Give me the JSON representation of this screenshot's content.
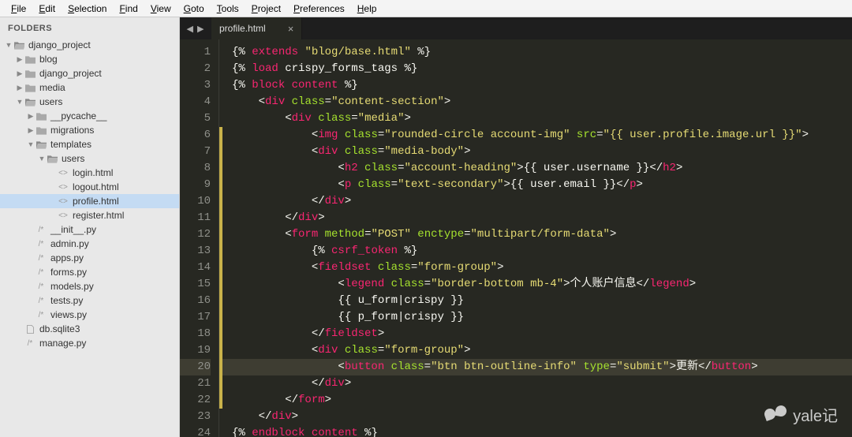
{
  "menu": {
    "items": [
      "File",
      "Edit",
      "Selection",
      "Find",
      "View",
      "Goto",
      "Tools",
      "Project",
      "Preferences",
      "Help"
    ]
  },
  "sidebar": {
    "heading": "FOLDERS",
    "tree": [
      {
        "depth": 1,
        "kind": "folder",
        "twist": "down",
        "label": "django_project"
      },
      {
        "depth": 2,
        "kind": "folder",
        "twist": "right",
        "label": "blog"
      },
      {
        "depth": 2,
        "kind": "folder",
        "twist": "right",
        "label": "django_project"
      },
      {
        "depth": 2,
        "kind": "folder",
        "twist": "right",
        "label": "media"
      },
      {
        "depth": 2,
        "kind": "folder",
        "twist": "down",
        "label": "users"
      },
      {
        "depth": 3,
        "kind": "folder",
        "twist": "right",
        "label": "__pycache__"
      },
      {
        "depth": 3,
        "kind": "folder",
        "twist": "right",
        "label": "migrations"
      },
      {
        "depth": 3,
        "kind": "folder",
        "twist": "down",
        "label": "templates"
      },
      {
        "depth": 4,
        "kind": "folder",
        "twist": "down",
        "label": "users"
      },
      {
        "depth": 5,
        "kind": "html",
        "twist": "",
        "label": "login.html"
      },
      {
        "depth": 5,
        "kind": "html",
        "twist": "",
        "label": "logout.html"
      },
      {
        "depth": 5,
        "kind": "html",
        "twist": "",
        "label": "profile.html",
        "selected": true
      },
      {
        "depth": 5,
        "kind": "html",
        "twist": "",
        "label": "register.html"
      },
      {
        "depth": 3,
        "kind": "py",
        "twist": "",
        "label": "__init__.py"
      },
      {
        "depth": 3,
        "kind": "py",
        "twist": "",
        "label": "admin.py"
      },
      {
        "depth": 3,
        "kind": "py",
        "twist": "",
        "label": "apps.py"
      },
      {
        "depth": 3,
        "kind": "py",
        "twist": "",
        "label": "forms.py"
      },
      {
        "depth": 3,
        "kind": "py",
        "twist": "",
        "label": "models.py"
      },
      {
        "depth": 3,
        "kind": "py",
        "twist": "",
        "label": "tests.py"
      },
      {
        "depth": 3,
        "kind": "py",
        "twist": "",
        "label": "views.py"
      },
      {
        "depth": 2,
        "kind": "file",
        "twist": "",
        "label": "db.sqlite3"
      },
      {
        "depth": 2,
        "kind": "py",
        "twist": "",
        "label": "manage.py"
      }
    ]
  },
  "tabs": {
    "nav": "◀ ▶",
    "open": [
      {
        "title": "profile.html",
        "close": "×"
      }
    ]
  },
  "code": {
    "active_line": 20,
    "lines": [
      [
        [
          "w",
          "{% "
        ],
        [
          "r",
          "extends"
        ],
        [
          "w",
          " "
        ],
        [
          "y",
          "\"blog/base.html\""
        ],
        [
          "w",
          " %}"
        ]
      ],
      [
        [
          "w",
          "{% "
        ],
        [
          "r",
          "load"
        ],
        [
          "w",
          " crispy_forms_tags %}"
        ]
      ],
      [
        [
          "w",
          "{% "
        ],
        [
          "r",
          "block content"
        ],
        [
          "w",
          " %}"
        ]
      ],
      [
        [
          "w",
          "    <"
        ],
        [
          "r",
          "div"
        ],
        [
          "w",
          " "
        ],
        [
          "g",
          "class"
        ],
        [
          "w",
          "="
        ],
        [
          "y",
          "\"content-section\""
        ],
        [
          "w",
          ">"
        ]
      ],
      [
        [
          "w",
          "        <"
        ],
        [
          "r",
          "div"
        ],
        [
          "w",
          " "
        ],
        [
          "g",
          "class"
        ],
        [
          "w",
          "="
        ],
        [
          "y",
          "\"media\""
        ],
        [
          "w",
          ">"
        ]
      ],
      [
        [
          "w",
          "            <"
        ],
        [
          "r",
          "img"
        ],
        [
          "w",
          " "
        ],
        [
          "g",
          "class"
        ],
        [
          "w",
          "="
        ],
        [
          "y",
          "\"rounded-circle account-img\""
        ],
        [
          "w",
          " "
        ],
        [
          "g",
          "src"
        ],
        [
          "w",
          "="
        ],
        [
          "y",
          "\"{{ user.profile.image.url }}\""
        ],
        [
          "w",
          ">"
        ]
      ],
      [
        [
          "w",
          "            <"
        ],
        [
          "r",
          "div"
        ],
        [
          "w",
          " "
        ],
        [
          "g",
          "class"
        ],
        [
          "w",
          "="
        ],
        [
          "y",
          "\"media-body\""
        ],
        [
          "w",
          ">"
        ]
      ],
      [
        [
          "w",
          "                <"
        ],
        [
          "r",
          "h2"
        ],
        [
          "w",
          " "
        ],
        [
          "g",
          "class"
        ],
        [
          "w",
          "="
        ],
        [
          "y",
          "\"account-heading\""
        ],
        [
          "w",
          ">{{ user.username }}</"
        ],
        [
          "r",
          "h2"
        ],
        [
          "w",
          ">"
        ]
      ],
      [
        [
          "w",
          "                <"
        ],
        [
          "r",
          "p"
        ],
        [
          "w",
          " "
        ],
        [
          "g",
          "class"
        ],
        [
          "w",
          "="
        ],
        [
          "y",
          "\"text-secondary\""
        ],
        [
          "w",
          ">{{ user.email }}</"
        ],
        [
          "r",
          "p"
        ],
        [
          "w",
          ">"
        ]
      ],
      [
        [
          "w",
          "            </"
        ],
        [
          "r",
          "div"
        ],
        [
          "w",
          ">"
        ]
      ],
      [
        [
          "w",
          "        </"
        ],
        [
          "r",
          "div"
        ],
        [
          "w",
          ">"
        ]
      ],
      [
        [
          "w",
          "        <"
        ],
        [
          "r",
          "form"
        ],
        [
          "w",
          " "
        ],
        [
          "g",
          "method"
        ],
        [
          "w",
          "="
        ],
        [
          "y",
          "\"POST\""
        ],
        [
          "w",
          " "
        ],
        [
          "g",
          "enctype"
        ],
        [
          "w",
          "="
        ],
        [
          "y",
          "\"multipart/form-data\""
        ],
        [
          "w",
          ">"
        ]
      ],
      [
        [
          "w",
          "            {% "
        ],
        [
          "r",
          "csrf_token"
        ],
        [
          "w",
          " %}"
        ]
      ],
      [
        [
          "w",
          "            <"
        ],
        [
          "r",
          "fieldset"
        ],
        [
          "w",
          " "
        ],
        [
          "g",
          "class"
        ],
        [
          "w",
          "="
        ],
        [
          "y",
          "\"form-group\""
        ],
        [
          "w",
          ">"
        ]
      ],
      [
        [
          "w",
          "                <"
        ],
        [
          "r",
          "legend"
        ],
        [
          "w",
          " "
        ],
        [
          "g",
          "class"
        ],
        [
          "w",
          "="
        ],
        [
          "y",
          "\"border-bottom mb-4\""
        ],
        [
          "w",
          ">个人账户信息</"
        ],
        [
          "r",
          "legend"
        ],
        [
          "w",
          ">"
        ]
      ],
      [
        [
          "w",
          "                {{ u_form|crispy }}"
        ]
      ],
      [
        [
          "w",
          "                {{ p_form|crispy }}"
        ]
      ],
      [
        [
          "w",
          "            </"
        ],
        [
          "r",
          "fieldset"
        ],
        [
          "w",
          ">"
        ]
      ],
      [
        [
          "w",
          "            <"
        ],
        [
          "r",
          "div"
        ],
        [
          "w",
          " "
        ],
        [
          "g",
          "class"
        ],
        [
          "w",
          "="
        ],
        [
          "y",
          "\"form-group\""
        ],
        [
          "w",
          ">"
        ]
      ],
      [
        [
          "w",
          "                <"
        ],
        [
          "r",
          "button"
        ],
        [
          "w",
          " "
        ],
        [
          "g",
          "class"
        ],
        [
          "w",
          "="
        ],
        [
          "y",
          "\"btn btn-outline-info\""
        ],
        [
          "w",
          " "
        ],
        [
          "g",
          "type"
        ],
        [
          "w",
          "="
        ],
        [
          "y",
          "\"submit\""
        ],
        [
          "w",
          ">更新</"
        ],
        [
          "r",
          "button"
        ],
        [
          "w",
          ">"
        ]
      ],
      [
        [
          "w",
          "            </"
        ],
        [
          "r",
          "div"
        ],
        [
          "w",
          ">"
        ]
      ],
      [
        [
          "w",
          "        </"
        ],
        [
          "r",
          "form"
        ],
        [
          "w",
          ">"
        ]
      ],
      [
        [
          "w",
          "    </"
        ],
        [
          "r",
          "div"
        ],
        [
          "w",
          ">"
        ]
      ],
      [
        [
          "w",
          "{% "
        ],
        [
          "r",
          "endblock content"
        ],
        [
          "w",
          " %}"
        ]
      ]
    ],
    "modified": [
      6,
      7,
      8,
      9,
      10,
      11,
      12,
      13,
      14,
      15,
      16,
      17,
      18,
      19,
      20,
      21,
      22
    ]
  },
  "watermark": "yale记"
}
